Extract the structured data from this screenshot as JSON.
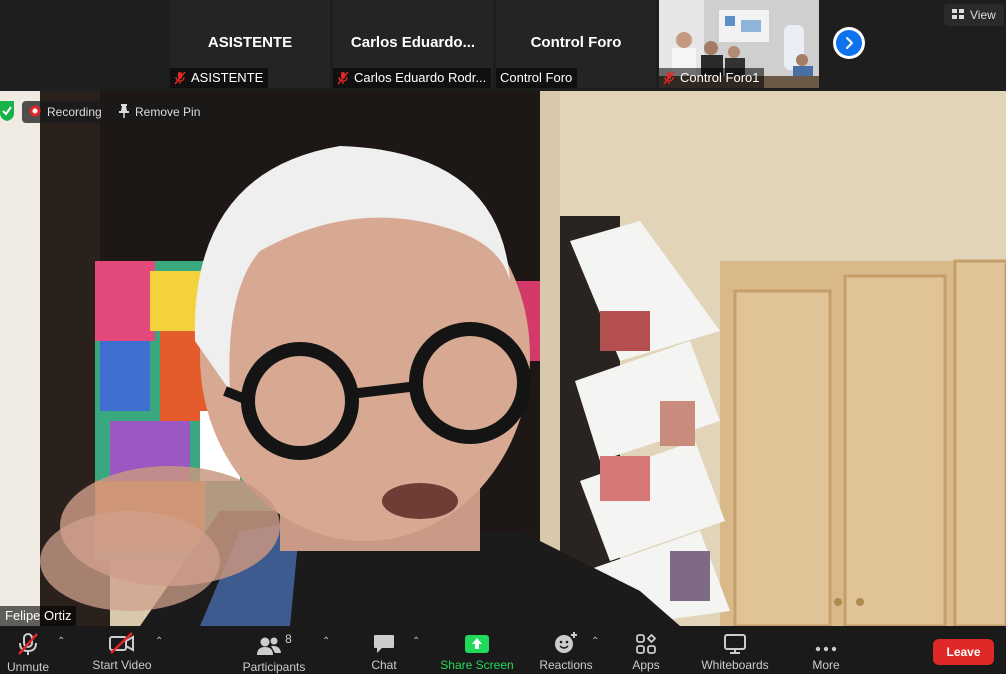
{
  "top_strip": {
    "tiles": [
      {
        "name": "ASISTENTE",
        "label": "ASISTENTE",
        "muted": true
      },
      {
        "name": "Carlos  Eduardo...",
        "label": "Carlos Eduardo Rodr...",
        "muted": true
      },
      {
        "name": "Control Foro",
        "label": "Control Foro",
        "muted": false
      },
      {
        "name": "",
        "label": "Control Foro1",
        "muted": true
      }
    ],
    "view_label": "View"
  },
  "main": {
    "recording_label": "Recording",
    "remove_pin_label": "Remove Pin",
    "speaker_name": "Felipe Ortiz"
  },
  "toolbar": {
    "unmute_label": "Unmute",
    "start_video_label": "Start Video",
    "participants_label": "Participants",
    "participants_count": "8",
    "chat_label": "Chat",
    "share_screen_label": "Share Screen",
    "reactions_label": "Reactions",
    "apps_label": "Apps",
    "whiteboards_label": "Whiteboards",
    "more_label": "More",
    "leave_label": "Leave"
  },
  "colors": {
    "accent": "#0e72ed",
    "share_green": "#23d959",
    "leave_red": "#e02828",
    "mute_red": "#e02828"
  }
}
